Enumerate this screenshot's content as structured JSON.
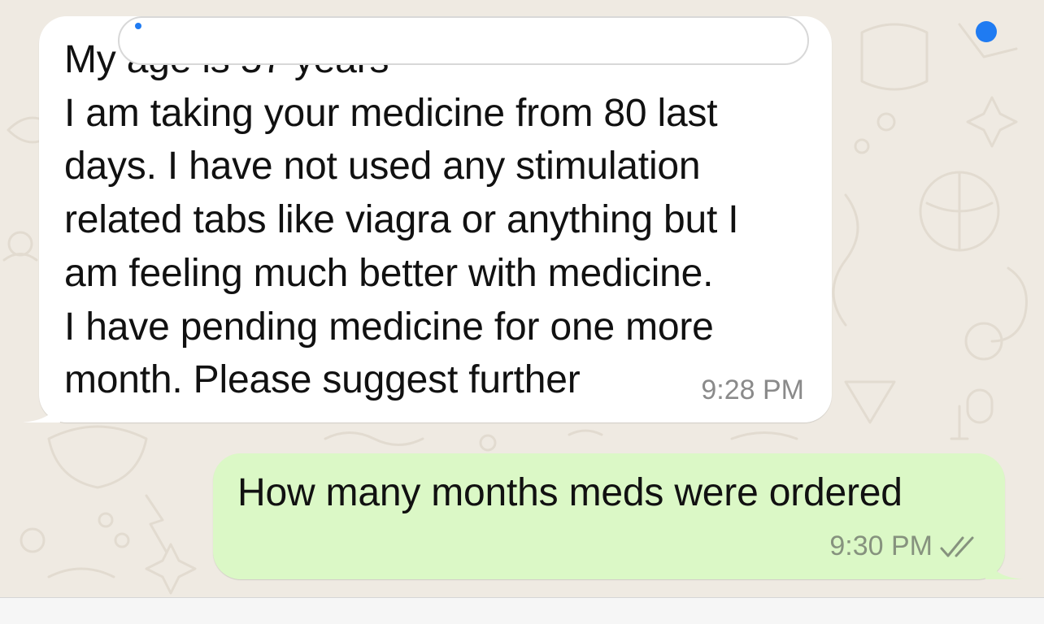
{
  "chat": {
    "messages": [
      {
        "direction": "incoming",
        "lines": [
          "My age is 57 years",
          "I am taking your medicine from 80 last",
          "days. I have not used any stimulation",
          "related tabs like viagra or anything but I",
          "am feeling much better with medicine.",
          "I have pending medicine for one more",
          "month. Please suggest further"
        ],
        "time": "9:28 PM"
      },
      {
        "direction": "outgoing",
        "text": "How many months meds were ordered",
        "time": "9:30 PM",
        "status_icon": "double-check-icon"
      }
    ]
  },
  "colors": {
    "wallpaper": "#EFEAE2",
    "incoming_bubble": "#FFFFFF",
    "outgoing_bubble": "#DBF8C6",
    "accent": "#1F7BF2"
  },
  "icons": {
    "attach": "attach-icon",
    "mic": "mic-icon"
  }
}
